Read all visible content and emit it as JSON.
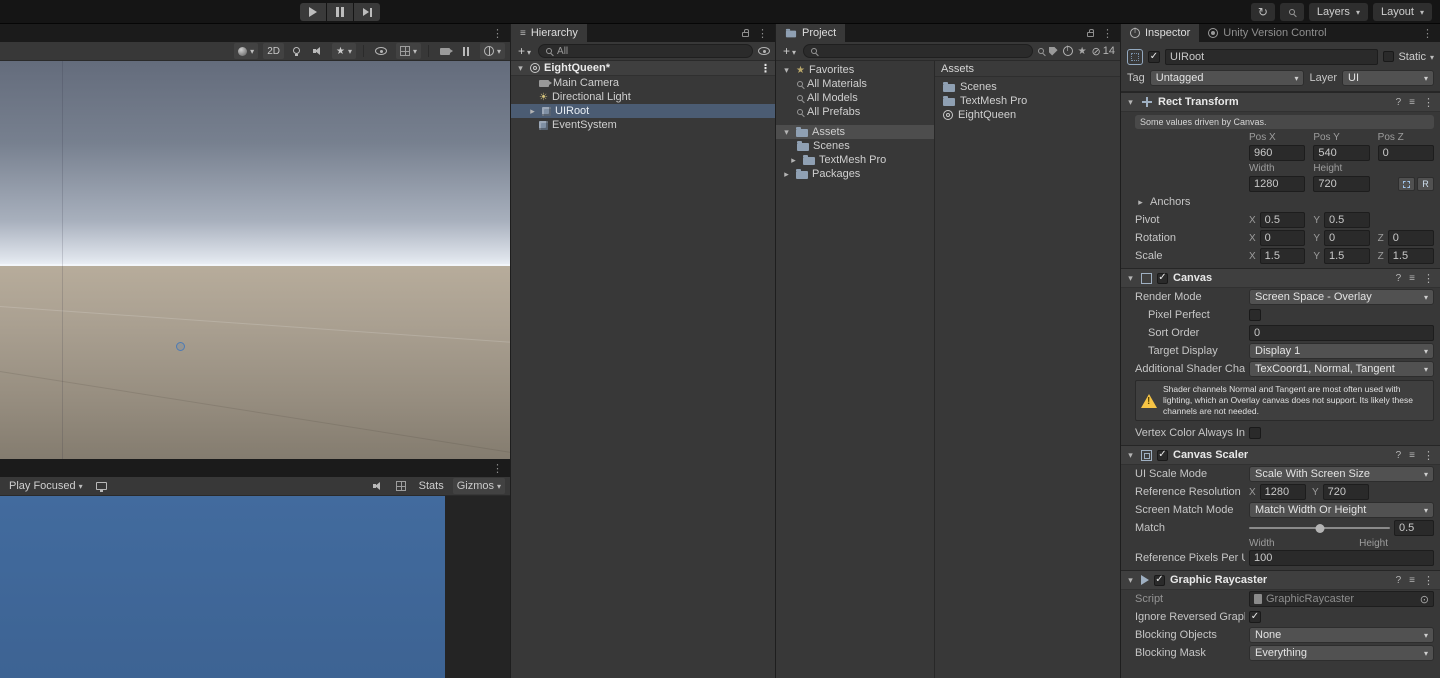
{
  "main_toolbar": {
    "layers": "Layers",
    "layout": "Layout"
  },
  "scene_view": {
    "mode_2d": "2D"
  },
  "game_view": {
    "play_focused": "Play Focused",
    "stats": "Stats",
    "gizmos": "Gizmos"
  },
  "hierarchy": {
    "tab": "Hierarchy",
    "create": "+",
    "search": "All",
    "scene": "EightQueen*",
    "items": [
      {
        "label": "Main Camera"
      },
      {
        "label": "Directional Light"
      },
      {
        "label": "UIRoot"
      },
      {
        "label": "EventSystem"
      }
    ]
  },
  "project": {
    "tab": "Project",
    "create": "+",
    "hidden": "14",
    "favorites": "Favorites",
    "fav_items": [
      {
        "label": "All Materials"
      },
      {
        "label": "All Models"
      },
      {
        "label": "All Prefabs"
      }
    ],
    "assets": "Assets",
    "scenes": "Scenes",
    "textmesh": "TextMesh Pro",
    "packages": "Packages",
    "content_header": "Assets",
    "content": [
      {
        "label": "Scenes"
      },
      {
        "label": "TextMesh Pro"
      },
      {
        "label": "EightQueen"
      }
    ]
  },
  "inspector": {
    "tab": "Inspector",
    "tab_vc": "Unity Version Control",
    "name": "UIRoot",
    "static": "Static",
    "tag_label": "Tag",
    "tag": "Untagged",
    "layer_label": "Layer",
    "layer": "UI",
    "axes": {
      "x": "X",
      "y": "Y",
      "z": "Z"
    },
    "rt": {
      "title": "Rect Transform",
      "note": "Some values driven by Canvas.",
      "col_x": "Pos X",
      "col_y": "Pos Y",
      "col_z": "Pos Z",
      "pos_x": "960",
      "pos_y": "540",
      "pos_z": "0",
      "w_label": "Width",
      "h_label": "Height",
      "w": "1280",
      "h": "720",
      "raw": "R",
      "anchors": "Anchors",
      "pivot": "Pivot",
      "pivot_x": "0.5",
      "pivot_y": "0.5",
      "rotation": "Rotation",
      "rot_x": "0",
      "rot_y": "0",
      "rot_z": "0",
      "scale": "Scale",
      "scale_x": "1.5",
      "scale_y": "1.5",
      "scale_z": "1.5"
    },
    "canvas": {
      "title": "Canvas",
      "render_mode_label": "Render Mode",
      "render_mode": "Screen Space - Overlay",
      "pixel_perfect": "Pixel Perfect",
      "sort_order_label": "Sort Order",
      "sort_order": "0",
      "target_display_label": "Target Display",
      "target_display": "Display 1",
      "shader_label": "Additional Shader Chan",
      "shader_value": "TexCoord1, Normal, Tangent",
      "warning": "Shader channels Normal and Tangent are most often used with lighting, which an Overlay canvas does not support. Its likely these channels are not needed.",
      "vertex_color": "Vertex Color Always In"
    },
    "scaler": {
      "title": "Canvas Scaler",
      "mode_label": "UI Scale Mode",
      "mode": "Scale With Screen Size",
      "ref_label": "Reference Resolution",
      "ref_x": "1280",
      "ref_y": "720",
      "match_mode_label": "Screen Match Mode",
      "match_mode": "Match Width Or Height",
      "match_label": "Match",
      "match": "0.5",
      "min": "Width",
      "max": "Height",
      "ppu_label": "Reference Pixels Per Un",
      "ppu": "100"
    },
    "raycaster": {
      "title": "Graphic Raycaster",
      "script_label": "Script",
      "script": "GraphicRaycaster",
      "ignore_label": "Ignore Reversed Graph",
      "blocking_objects_label": "Blocking Objects",
      "blocking_objects": "None",
      "blocking_mask_label": "Blocking Mask",
      "blocking_mask": "Everything"
    }
  }
}
